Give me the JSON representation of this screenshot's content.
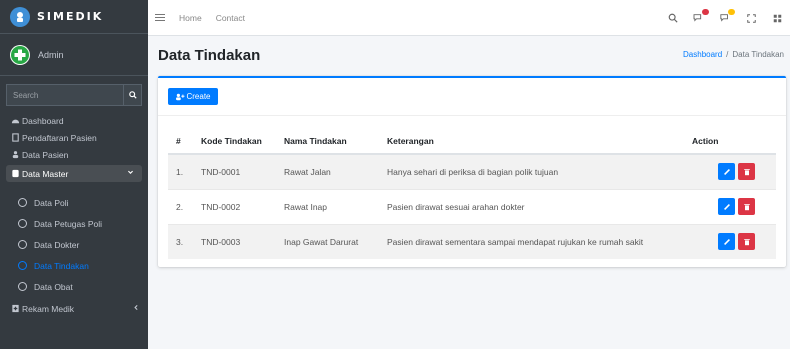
{
  "brand": {
    "name": "SIMEDIK"
  },
  "user": {
    "name": "Admin"
  },
  "sidebar": {
    "search_placeholder": "Search",
    "items": [
      {
        "label": "Dashboard",
        "icon": "tachometer-icon"
      },
      {
        "label": "Pendaftaran Pasien",
        "icon": "clipboard-icon"
      },
      {
        "label": "Data Pasien",
        "icon": "users-icon"
      },
      {
        "label": "Data Master",
        "icon": "database-icon",
        "active": true,
        "expanded": true
      },
      {
        "label": "Rekam Medik",
        "icon": "book-medical-icon"
      }
    ],
    "submenu": [
      {
        "label": "Data Poli"
      },
      {
        "label": "Data Petugas Poli"
      },
      {
        "label": "Data Dokter"
      },
      {
        "label": "Data Tindakan",
        "active": true
      },
      {
        "label": "Data Obat"
      }
    ]
  },
  "navbar": {
    "links": [
      "Home",
      "Contact"
    ],
    "icons": [
      "search-icon",
      "comments-icon",
      "bell-icon",
      "expand-icon",
      "grid-icon"
    ]
  },
  "header": {
    "title": "Data Tindakan",
    "breadcrumb": {
      "link": "Dashboard",
      "separator": "/",
      "current": "Data Tindakan"
    }
  },
  "card": {
    "create_label": "Create",
    "columns": [
      "#",
      "Kode Tindakan",
      "Nama Tindakan",
      "Keterangan",
      "Action"
    ],
    "rows": [
      {
        "no": "1.",
        "kode": "TND-0001",
        "nama": "Rawat Jalan",
        "keterangan": "Hanya sehari di periksa di bagian polik tujuan"
      },
      {
        "no": "2.",
        "kode": "TND-0002",
        "nama": "Rawat Inap",
        "keterangan": "Pasien dirawat sesuai arahan dokter"
      },
      {
        "no": "3.",
        "kode": "TND-0003",
        "nama": "Inap Gawat Darurat",
        "keterangan": "Pasien dirawat sementara sampai mendapat rujukan ke rumah sakit"
      }
    ]
  },
  "colors": {
    "sidebar_bg": "#343a40",
    "primary": "#007bff",
    "danger": "#dc3545",
    "active_submenu": "#007bff"
  }
}
